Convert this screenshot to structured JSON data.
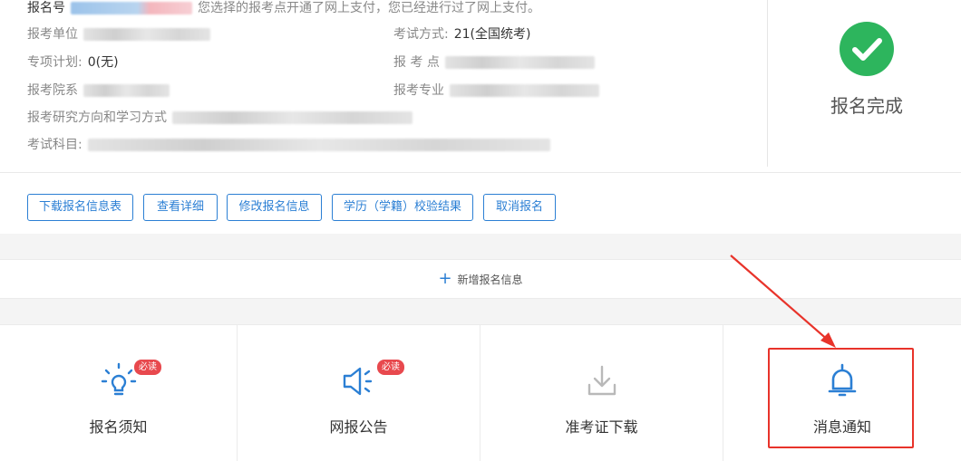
{
  "registration": {
    "id_label": "报名号",
    "id_note": "您选择的报考点开通了网上支付，您已经进行过了网上支付。",
    "unit_label": "报考单位",
    "exam_mode_label": "考试方式:",
    "exam_mode_value": "21(全国统考)",
    "special_plan_label": "专项计划:",
    "special_plan_value": "0(无)",
    "exam_site_label": "报 考 点",
    "department_label": "报考院系",
    "major_label": "报考专业",
    "direction_label": "报考研究方向和学习方式",
    "subjects_label": "考试科目:",
    "status_text": "报名完成"
  },
  "actions": [
    {
      "label": "下载报名信息表"
    },
    {
      "label": "查看详细"
    },
    {
      "label": "修改报名信息"
    },
    {
      "label": "学历（学籍）校验结果"
    },
    {
      "label": "取消报名"
    }
  ],
  "add_entry": {
    "label": "新增报名信息",
    "icon": "plus-icon"
  },
  "tiles": [
    {
      "label": "报名须知",
      "badge": "必读",
      "icon": "lightbulb-icon"
    },
    {
      "label": "网报公告",
      "badge": "必读",
      "icon": "megaphone-icon"
    },
    {
      "label": "准考证下载",
      "icon": "download-icon"
    },
    {
      "label": "消息通知",
      "icon": "bell-icon"
    }
  ],
  "colors": {
    "primary": "#2b7fd4",
    "success": "#2db55d",
    "badge": "#e8494e",
    "annotation": "#e8332a"
  }
}
